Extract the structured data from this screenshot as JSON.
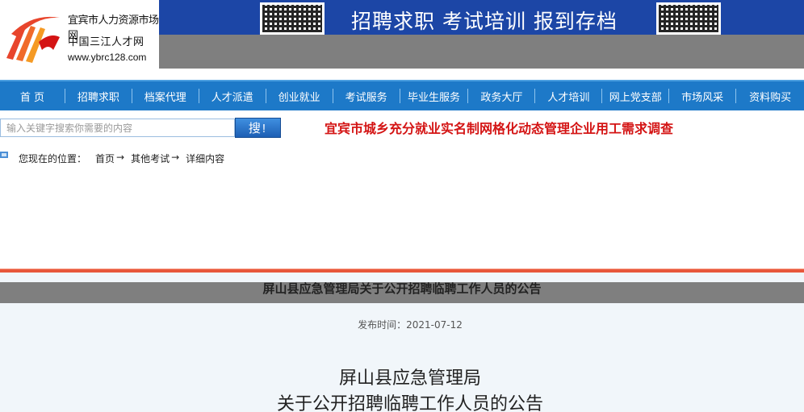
{
  "logo": {
    "line1": "宜宾市人力资源市场网",
    "line2": "中国三江人才网",
    "url": "www.ybrc128.com"
  },
  "banner": {
    "slogan": "招聘求职  考试培训  报到存档"
  },
  "nav": {
    "items": [
      "首  页",
      "招聘求职",
      "档案代理",
      "人才派遣",
      "创业就业",
      "考试服务",
      "毕业生服务",
      "政务大厅",
      "人才培训",
      "网上党支部",
      "市场风采",
      "资料购买"
    ]
  },
  "search": {
    "placeholder": "输入关键字搜索你需要的内容",
    "button_label": "搜!"
  },
  "survey_link": "宜宾市城乡充分就业实名制网格化动态管理企业用工需求调查",
  "breadcrumb": {
    "label": "您现在的位置：",
    "items": [
      "首页",
      "其他考试",
      "详细内容"
    ],
    "arrow": "→"
  },
  "article": {
    "title": "屏山县应急管理局关于公开招聘临聘工作人员的公告",
    "publish_time": "发布时间：2021-07-12",
    "body_line1": "屏山县应急管理局",
    "body_line2": "关于公开招聘临聘工作人员的公告"
  },
  "colors": {
    "nav_bg": "#1d79c8",
    "banner_blue": "#1c46a6",
    "accent_red": "#d41414",
    "divider_orange": "#e8573a",
    "content_bg": "#f1f6fa"
  }
}
